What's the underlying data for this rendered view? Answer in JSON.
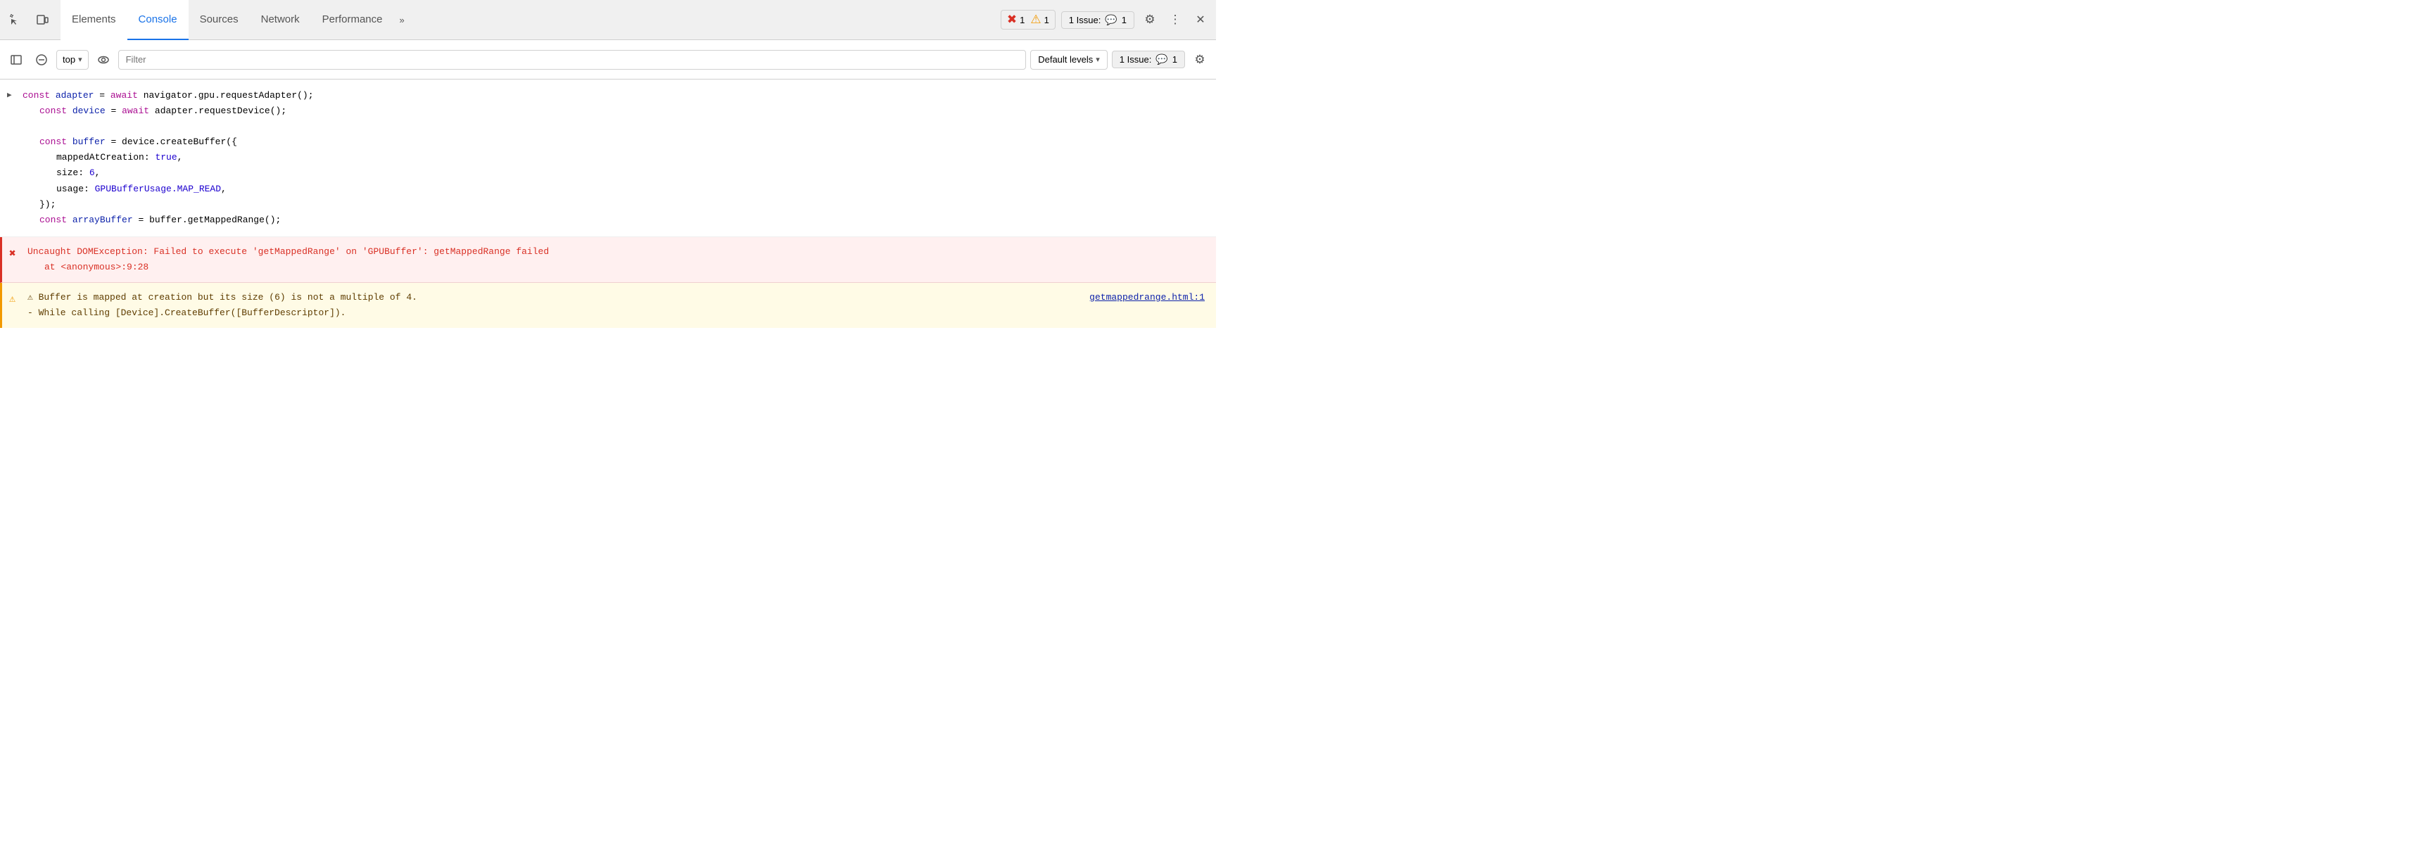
{
  "tabs": {
    "items": [
      {
        "id": "elements",
        "label": "Elements",
        "active": false
      },
      {
        "id": "console",
        "label": "Console",
        "active": true
      },
      {
        "id": "sources",
        "label": "Sources",
        "active": false
      },
      {
        "id": "network",
        "label": "Network",
        "active": false
      },
      {
        "id": "performance",
        "label": "Performance",
        "active": false
      },
      {
        "id": "more",
        "label": "»",
        "active": false
      }
    ],
    "error_count": "1",
    "warn_count": "1",
    "info_count": "1",
    "issue_label": "1 Issue:",
    "issue_count": "1"
  },
  "toolbar": {
    "context_label": "top",
    "filter_placeholder": "Filter",
    "levels_label": "Default levels"
  },
  "console": {
    "code_lines": [
      {
        "type": "code",
        "has_arrow": true,
        "content": "code_block_1"
      },
      {
        "type": "error",
        "content": "error_block"
      },
      {
        "type": "warning",
        "content": "warn_block"
      }
    ],
    "code_block_1": {
      "line1_kw": "const",
      "line1_var": "adapter",
      "line1_eq": " = ",
      "line1_await": "await",
      "line1_call": " navigator.gpu.requestAdapter();",
      "line2_kw": "const",
      "line2_var": "device",
      "line2_eq": " = ",
      "line2_await": "await",
      "line2_call": " adapter.requestDevice();",
      "line3_blank": "",
      "line4_kw": "const",
      "line4_var": "buffer",
      "line4_eq": " = ",
      "line4_call": "device.createBuffer({",
      "line5_prop": "mappedAtCreation:",
      "line5_val": "true",
      "line5_comma": ",",
      "line6_prop": "size:",
      "line6_num": "6",
      "line6_comma": ",",
      "line7_prop": "usage:",
      "line7_val": "GPUBufferUsage.MAP_READ",
      "line7_comma": ",",
      "line8": "});",
      "line9_kw": "const",
      "line9_var": "arrayBuffer",
      "line9_eq": " = ",
      "line9_call": "buffer.getMappedRange();"
    },
    "error_text": "Uncaught DOMException: Failed to execute 'getMappedRange' on 'GPUBuffer': getMappedRange failed",
    "error_location": "at <anonymous>:9:28",
    "warn_text_line1": "⚠ Buffer is mapped at creation but its size (6) is not a multiple of 4.",
    "warn_text_line2": " - While calling [Device].CreateBuffer([BufferDescriptor]).",
    "warn_link": "getmappedrange.html:1"
  },
  "icons": {
    "inspect": "⋯",
    "device": "⬜",
    "sidebar": "▶",
    "clear": "⊘",
    "eye": "👁",
    "chevron_down": "▾",
    "gear": "⚙",
    "more_vert": "⋮",
    "close": "✕",
    "error_circle": "🔴",
    "warn_triangle": "⚠",
    "info_square": "💬",
    "error_mark": "✖"
  }
}
